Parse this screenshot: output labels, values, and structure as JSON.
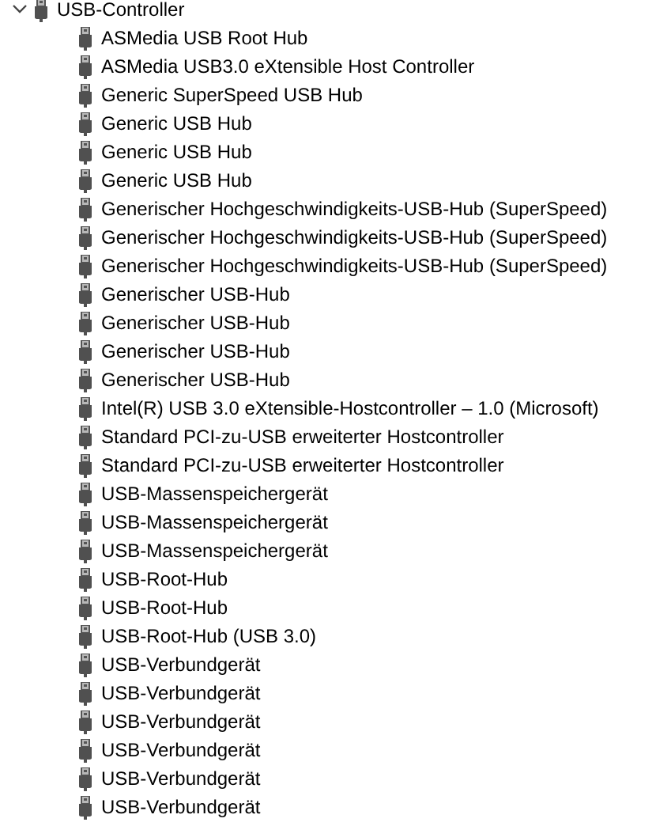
{
  "tree": {
    "label": "USB-Controller",
    "expanded": true,
    "children": [
      {
        "label": "ASMedia USB Root Hub"
      },
      {
        "label": "ASMedia USB3.0 eXtensible Host Controller"
      },
      {
        "label": "Generic SuperSpeed USB Hub"
      },
      {
        "label": "Generic USB Hub"
      },
      {
        "label": "Generic USB Hub"
      },
      {
        "label": "Generic USB Hub"
      },
      {
        "label": "Generischer Hochgeschwindigkeits-USB-Hub (SuperSpeed)"
      },
      {
        "label": "Generischer Hochgeschwindigkeits-USB-Hub (SuperSpeed)"
      },
      {
        "label": "Generischer Hochgeschwindigkeits-USB-Hub (SuperSpeed)"
      },
      {
        "label": "Generischer USB-Hub"
      },
      {
        "label": "Generischer USB-Hub"
      },
      {
        "label": "Generischer USB-Hub"
      },
      {
        "label": "Generischer USB-Hub"
      },
      {
        "label": "Intel(R) USB 3.0 eXtensible-Hostcontroller – 1.0 (Microsoft)"
      },
      {
        "label": "Standard PCI-zu-USB erweiterter Hostcontroller"
      },
      {
        "label": "Standard PCI-zu-USB erweiterter Hostcontroller"
      },
      {
        "label": "USB-Massenspeichergerät"
      },
      {
        "label": "USB-Massenspeichergerät"
      },
      {
        "label": "USB-Massenspeichergerät"
      },
      {
        "label": "USB-Root-Hub"
      },
      {
        "label": "USB-Root-Hub"
      },
      {
        "label": "USB-Root-Hub (USB 3.0)"
      },
      {
        "label": "USB-Verbundgerät"
      },
      {
        "label": "USB-Verbundgerät"
      },
      {
        "label": "USB-Verbundgerät"
      },
      {
        "label": "USB-Verbundgerät"
      },
      {
        "label": "USB-Verbundgerät"
      },
      {
        "label": "USB-Verbundgerät"
      }
    ]
  }
}
